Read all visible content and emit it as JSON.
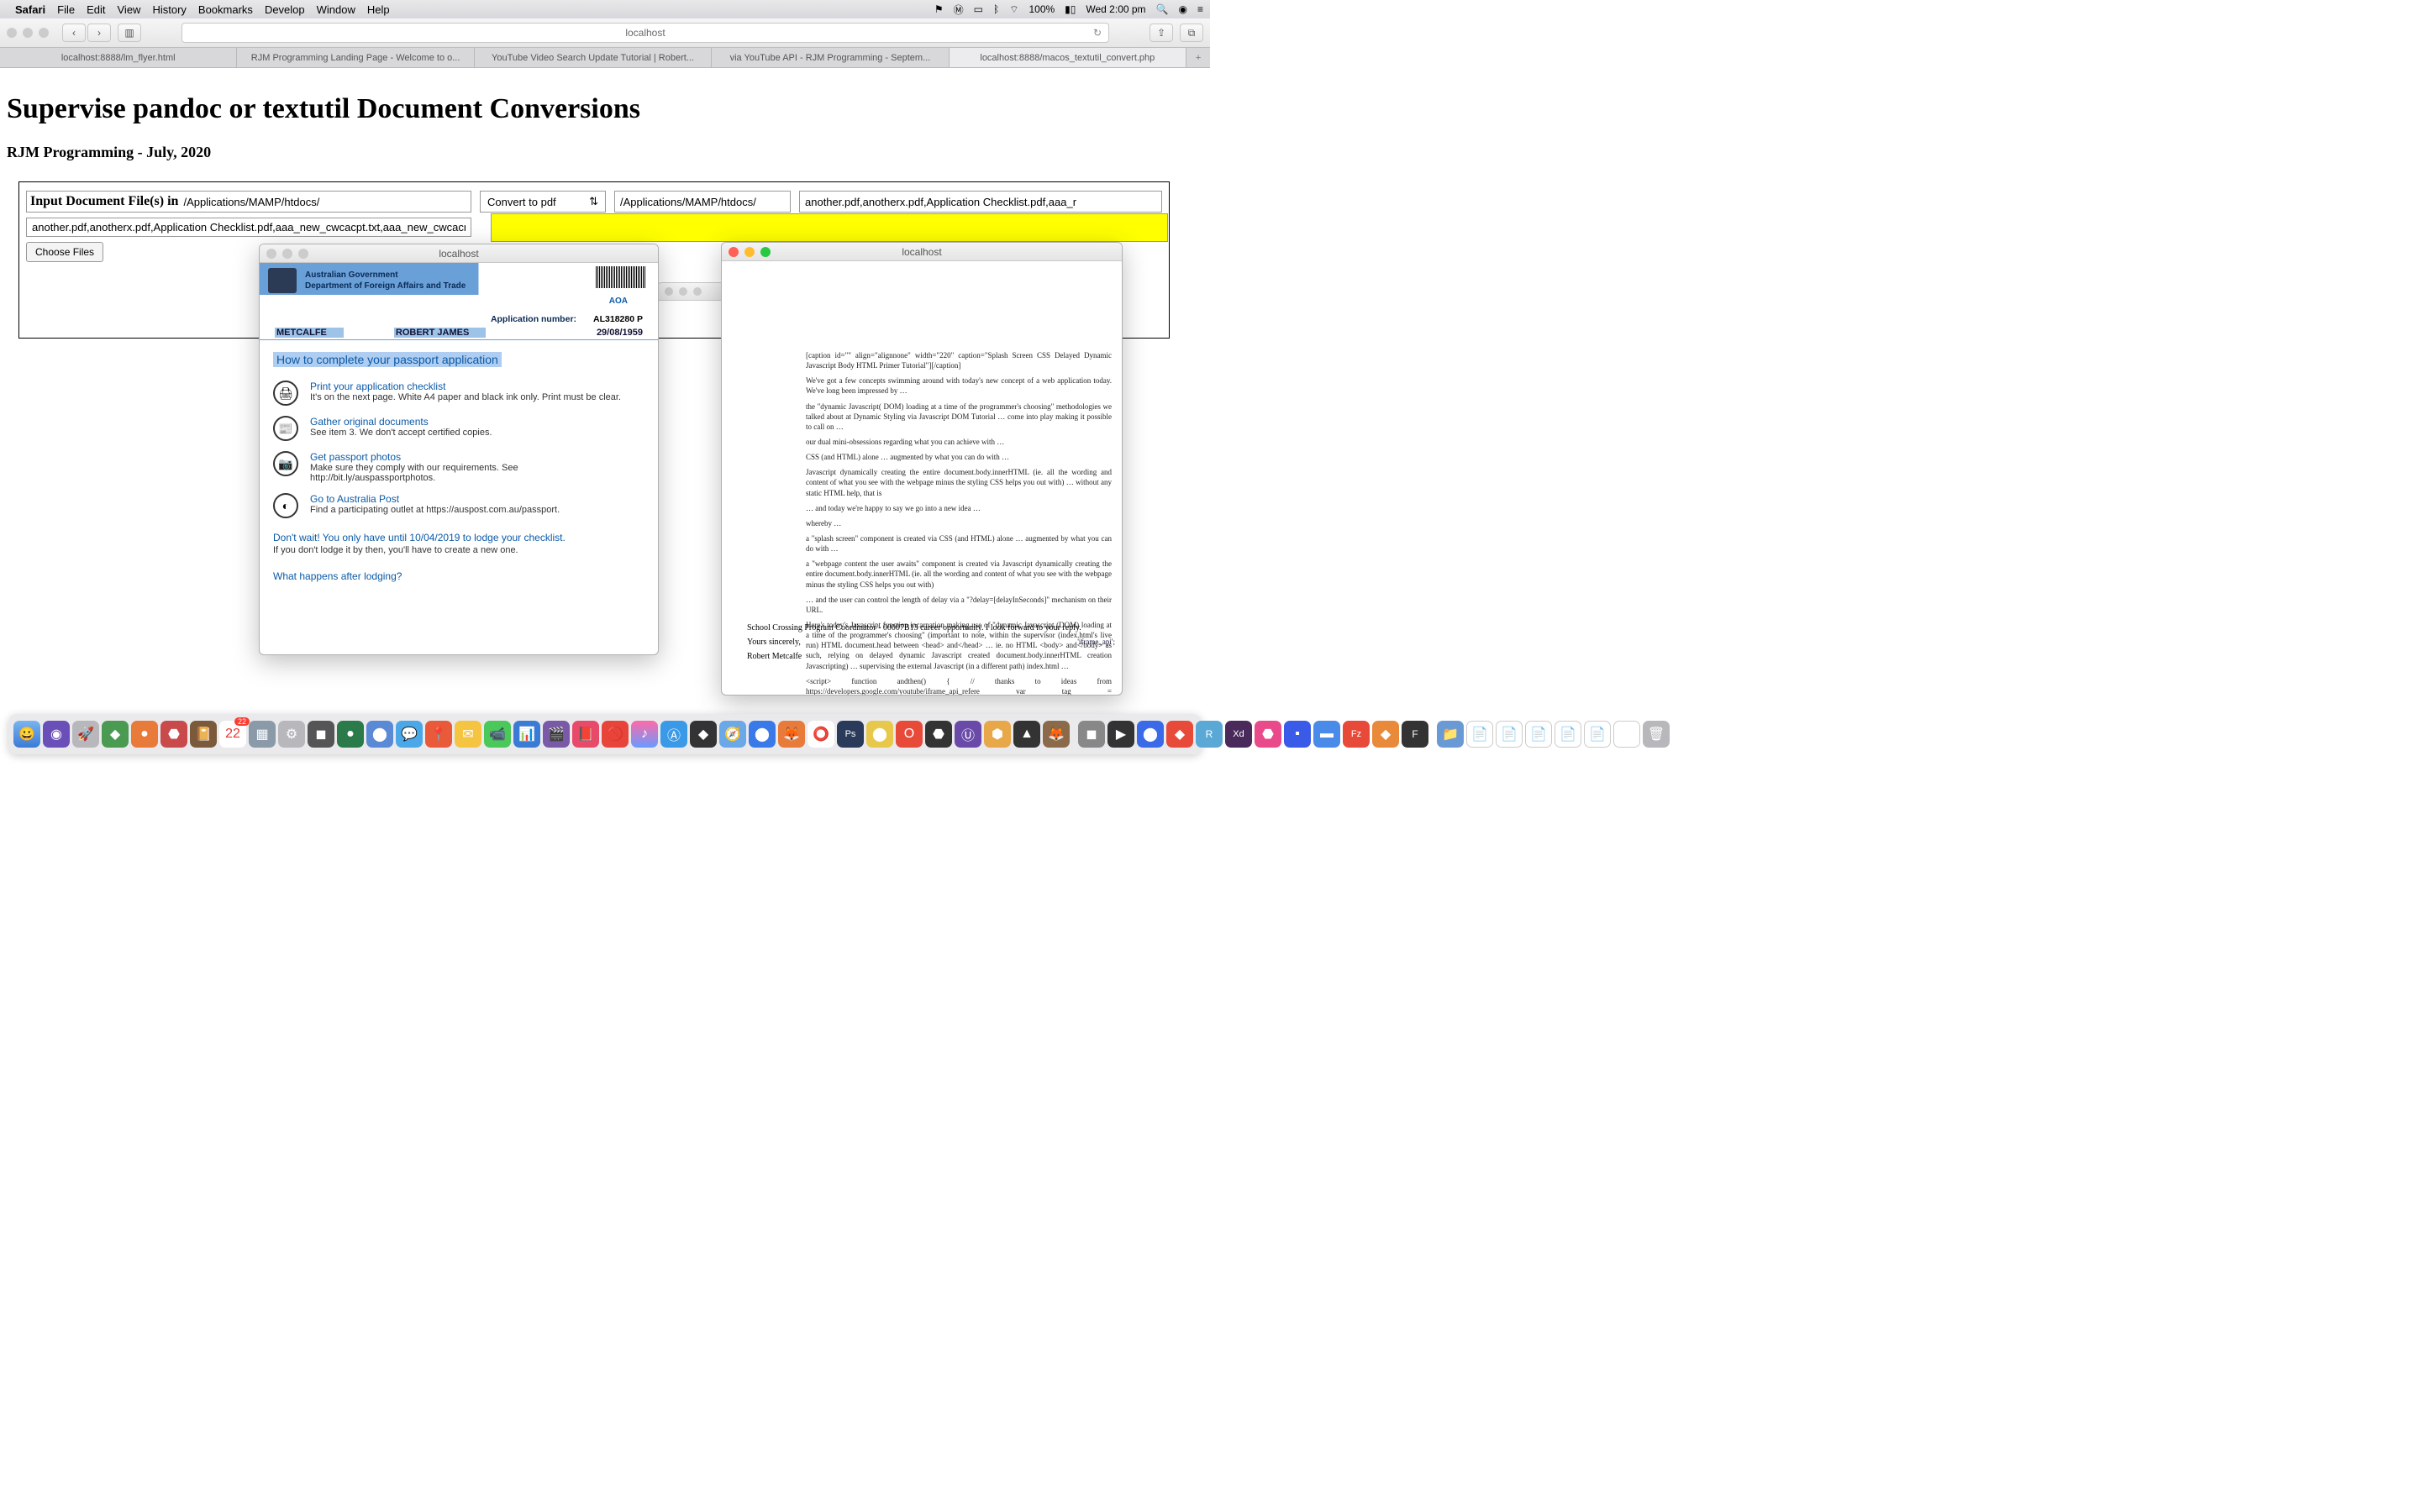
{
  "menubar": {
    "apple": "",
    "app": "Safari",
    "items": [
      "File",
      "Edit",
      "View",
      "History",
      "Bookmarks",
      "Develop",
      "Window",
      "Help"
    ],
    "battery": "100%",
    "clock": "Wed 2:00 pm"
  },
  "safari": {
    "url": "localhost",
    "tabs": [
      "localhost:8888/lm_flyer.html",
      "RJM Programming Landing Page - Welcome to o...",
      "YouTube Video Search Update Tutorial | Robert...",
      "via YouTube API - RJM Programming - Septem...",
      "localhost:8888/macos_textutil_convert.php"
    ],
    "active_tab": 4
  },
  "page": {
    "h1": "Supervise pandoc or textutil Document Conversions",
    "h2": "RJM Programming - July, 2020",
    "input_label": "Input Document File(s) in",
    "input_dir": "/Applications/MAMP/htdocs/",
    "file_list": "another.pdf,anotherx.pdf,Application Checklist.pdf,aaa_new_cwcacpt.txt,aaa_new_cwcacrt.tx",
    "choose": "Choose Files",
    "convert_label": "Convert to pdf",
    "output_dir": "/Applications/MAMP/htdocs/",
    "output_files": "another.pdf,anotherx.pdf,Application Checklist.pdf,aaa_r"
  },
  "popup1": {
    "title": "localhost",
    "gov1": "Australian Government",
    "gov2": "Department of Foreign Affairs and Trade",
    "aoa": "AOA",
    "appno_label": "Application number:",
    "appno": "AL318280 P",
    "surname": "METCALFE",
    "given": "ROBERT JAMES",
    "dob": "29/08/1959",
    "howto": "How to complete your passport application",
    "steps": [
      {
        "t": "Print your application checklist",
        "d": "It's on the next page. White A4 paper and black ink only. Print must be clear.",
        "i": "🖨"
      },
      {
        "t": "Gather original documents",
        "d": "See item 3. We don't accept certified copies.",
        "i": "📰"
      },
      {
        "t": "Get passport photos",
        "d": "Make sure they comply with our requirements. See http://bit.ly/auspassportphotos.",
        "i": "📷"
      },
      {
        "t": "Go to Australia Post",
        "d": "Find a participating outlet at https://auspost.com.au/passport.",
        "i": "◐"
      }
    ],
    "note": "Don't wait! You only have until 10/04/2019 to lodge your checklist.",
    "note2": "If you don't lodge it by then, you'll have to create a new one.",
    "after": "What happens after lodging?"
  },
  "popup2": {
    "title": "localhost",
    "paras": [
      "[caption id=\"\" align=\"alignnone\" width=\"220\" caption=\"Splash Screen CSS Delayed Dynamic Javascript Body HTML Primer Tutorial\"][/caption]",
      "We've got a few concepts swimming around with today's new concept of a web application today. We've long been impressed by …",
      "the \"dynamic Javascript( DOM) loading at a time of the programmer's choosing\" methodologies we talked about at Dynamic Styling via Javascript DOM Tutorial … come into play making it possible to call on …",
      "our dual mini-obsessions regarding what you can achieve with …",
      "CSS (and HTML) alone … augmented by what you can do with …",
      "Javascript dynamically creating the entire document.body.innerHTML (ie. all the wording and content of what you see with the webpage minus the styling CSS helps you out with) … without any static HTML help, that is",
      "… and today we're happy to say we go into a new idea …",
      "whereby …",
      "a \"splash screen\" component is created via CSS (and HTML) alone … augmented by what you can do with …",
      "a \"webpage content the user awaits\" component is created via Javascript dynamically creating the entire document.body.innerHTML (ie. all the wording and content of what you see with the webpage minus the styling CSS helps you out with)",
      "… and the user can control the length of delay via a \"?delay=[delayInSeconds]\" mechanism on their URL.",
      "Here's today's Javascript function incarnation making use of \"dynamic Javascript (DOM) loading at a time of the programmer's choosing\" (important to note, within the supervisor (index.html's live run) HTML document.head between <head> and</head> … ie. no HTML <body> and</body> as such, relying on delayed dynamic Javascript created document.body.innerHTML creation Javascripting) … supervising the external Javascript (in a different path) index.html …",
      "<script> function andthen() { // thanks to ideas from https://developers.google.com/youtube/iframe_api_refere  var tag = document.createElement('script'); tag.src = document.URL.split('//')[0] + '//' + document.URL.split('//')[1].split('/')[0] + \"/spare/js/\"; var"
    ],
    "sig1": "School Crossing Program Coordinator - 00007B13 career opportunity. I look forward to your reply.",
    "sig2": "Yours sincerely,",
    "sig3": "Robert Metcalfe",
    "iframe_label": "'iframe_api';"
  },
  "dock": {
    "cal_badge": "22"
  }
}
